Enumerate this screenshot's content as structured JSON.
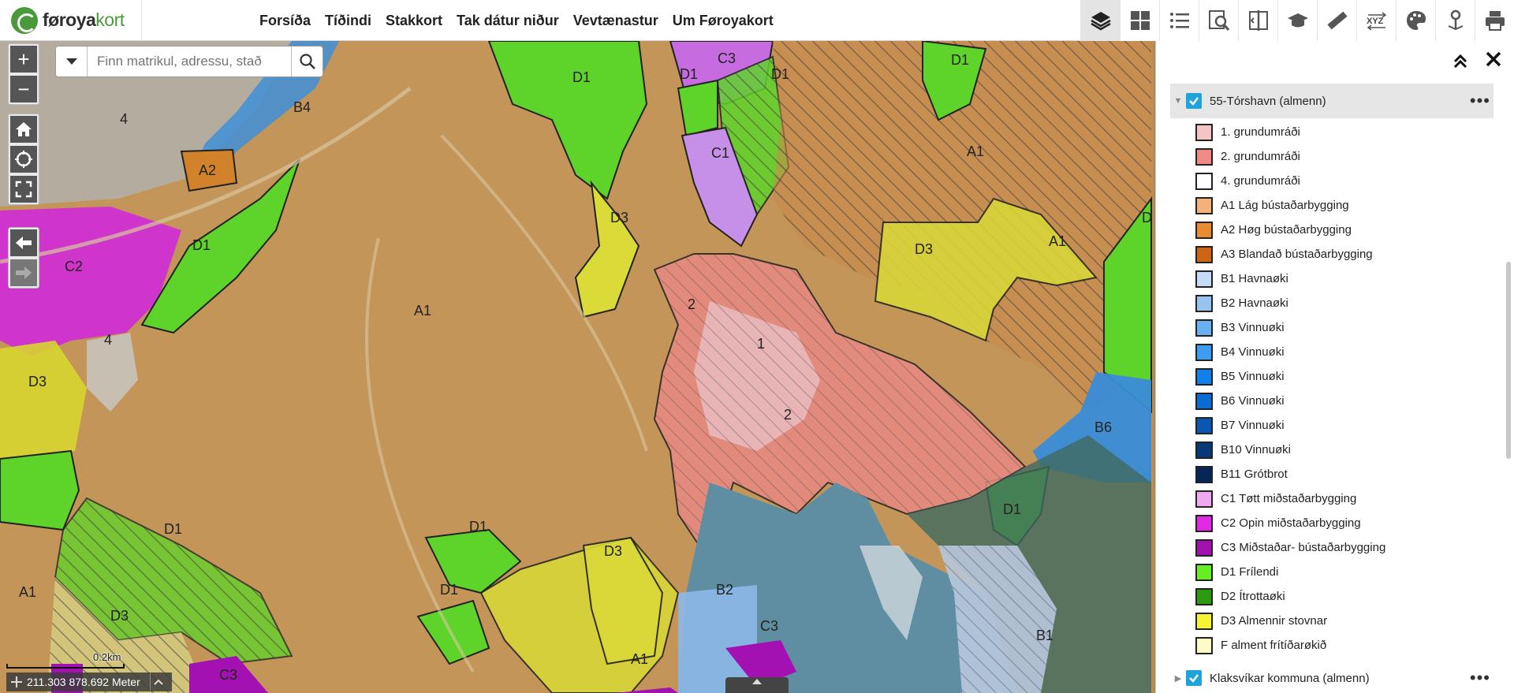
{
  "app": {
    "logo_text_a": "føroya",
    "logo_text_b": "kort"
  },
  "nav": [
    {
      "label": "Forsíða"
    },
    {
      "label": "Tíðindi"
    },
    {
      "label": "Stakkort"
    },
    {
      "label": "Tak dátur niður"
    },
    {
      "label": "Vevtænastur"
    },
    {
      "label": "Um Føroyakort"
    }
  ],
  "toolbar": {
    "icons": [
      "layers-icon",
      "basemap-grid-icon",
      "legend-list-icon",
      "search-map-icon",
      "compare-split-icon",
      "education-cap-icon",
      "measure-ruler-icon",
      "coordinates-xyz-icon",
      "palette-icon",
      "location-pin-icon",
      "print-icon"
    ],
    "xyz_label": "XYZ"
  },
  "search": {
    "placeholder": "Finn matrikul, adressu, stað"
  },
  "map": {
    "zoom_in": "+",
    "zoom_out": "−",
    "scale_label": "0.2km",
    "coords": "211.303 878.692 Meter",
    "zone_labels": [
      "4",
      "B4",
      "A2",
      "D1",
      "C2",
      "4",
      "D3",
      "A1",
      "D1",
      "A1",
      "D3",
      "D1",
      "D1",
      "D3",
      "D1",
      "C3",
      "D1",
      "C1",
      "D3",
      "2",
      "1",
      "2",
      "B2",
      "C3",
      "A1",
      "A1",
      "D3",
      "A1",
      "B6",
      "D1",
      "B1",
      "D",
      "C3"
    ]
  },
  "panel": {
    "groups": [
      {
        "label": "55-Tórshavn (almenn)",
        "more": "•••"
      },
      {
        "label": "Klaksvíkar kommuna (almenn)",
        "more": "•••"
      }
    ],
    "legend": [
      {
        "label": "1. grundumráði",
        "color": "#f5c4c4"
      },
      {
        "label": "2. grundumráði",
        "color": "#ef8a86"
      },
      {
        "label": "4. grundumráði",
        "color": "#ffffff"
      },
      {
        "label": "A1 Lág bústaðarbygging",
        "color": "#f2b27a"
      },
      {
        "label": "A2 Høg bústaðarbygging",
        "color": "#e98b2e"
      },
      {
        "label": "A3 Blandað bústaðarbygging",
        "color": "#cc6416"
      },
      {
        "label": "B1 Havnaøki",
        "color": "#c4dcf5"
      },
      {
        "label": "B2 Havnaøki",
        "color": "#97c3ef"
      },
      {
        "label": "B3 Vinnuøki",
        "color": "#6ab0f0"
      },
      {
        "label": "B4 Vinnuøki",
        "color": "#3b9cf0"
      },
      {
        "label": "B5 Vinnuøki",
        "color": "#1180ea"
      },
      {
        "label": "B6 Vinnuøki",
        "color": "#0d6bd4"
      },
      {
        "label": "B7 Vinnuøki",
        "color": "#0a56b0"
      },
      {
        "label": "B10 Vinnuøki",
        "color": "#083877"
      },
      {
        "label": "B11 Grótbrot",
        "color": "#06265a"
      },
      {
        "label": "C1 Tøtt miðstaðarbygging",
        "color": "#f0a8f0"
      },
      {
        "label": "C2 Opin miðstaðarbygging",
        "color": "#e02ae6"
      },
      {
        "label": "C3 Miðstaðar- bústaðarbygging",
        "color": "#a211b0"
      },
      {
        "label": "D1 Frílendi",
        "color": "#66ee22"
      },
      {
        "label": "D2 Ítrottaøki",
        "color": "#2b9a10"
      },
      {
        "label": "D3 Almennir stovnar",
        "color": "#f5f533"
      },
      {
        "label": "F alment frítíðarøkið",
        "color": "#fffbc8"
      }
    ]
  }
}
